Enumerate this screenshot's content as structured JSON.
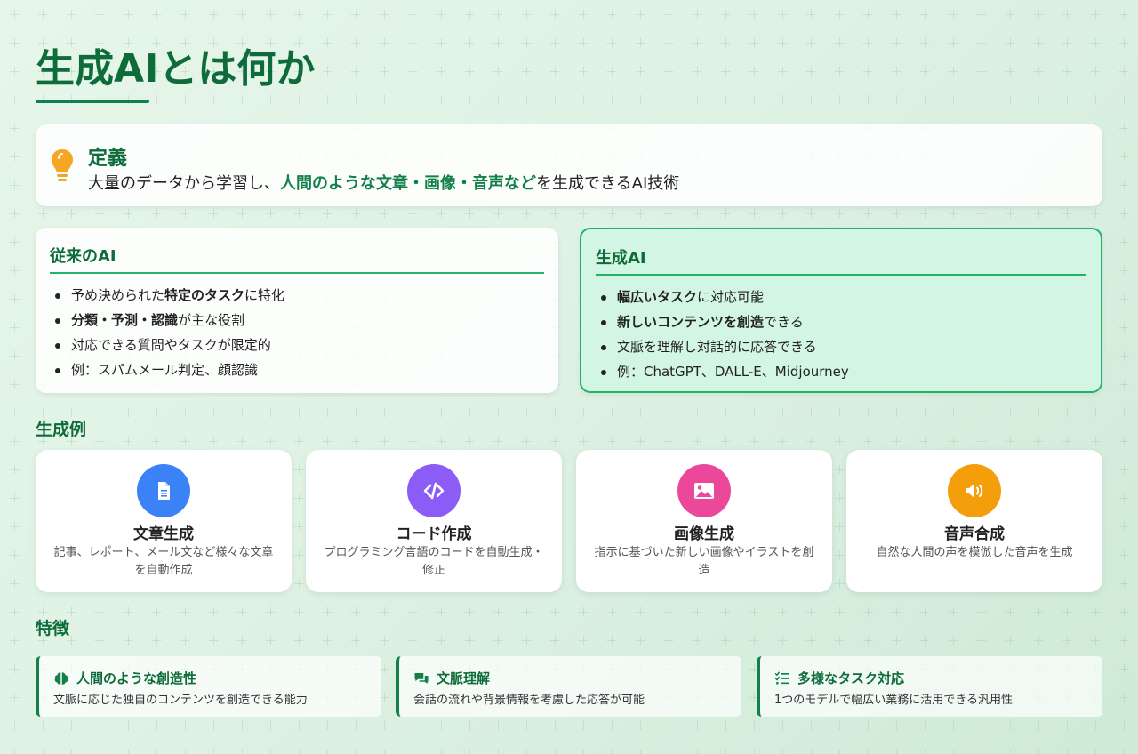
{
  "title": "生成AIとは何か",
  "definition": {
    "heading": "定義",
    "text_before": "大量のデータから学習し、",
    "highlight": "人間のような文章・画像・音声など",
    "text_after": "を生成できるAI技術",
    "icon": "lightbulb-icon"
  },
  "traditional": {
    "heading": "従来のAI",
    "items": [
      {
        "pre": "予め決められた",
        "bold": "特定のタスク",
        "post": "に特化"
      },
      {
        "pre": "",
        "bold": "分類・予測・認識",
        "post": "が主な役割"
      },
      {
        "pre": "対応できる質問やタスクが限定的",
        "bold": "",
        "post": ""
      },
      {
        "pre": "例：スパムメール判定、顔認識",
        "bold": "",
        "post": ""
      }
    ]
  },
  "generative": {
    "heading": "生成AI",
    "items": [
      {
        "pre": "",
        "bold": "幅広いタスク",
        "post": "に対応可能"
      },
      {
        "pre": "",
        "bold": "新しいコンテンツを創造",
        "post": "できる"
      },
      {
        "pre": "文脈を理解し対話的に応答できる",
        "bold": "",
        "post": ""
      },
      {
        "pre": "例：ChatGPT、DALL-E、Midjourney",
        "bold": "",
        "post": ""
      }
    ]
  },
  "examples_heading": "生成例",
  "examples": [
    {
      "title": "文章生成",
      "desc": "記事、レポート、メール文など様々な文章を自動作成",
      "icon": "document-icon",
      "color": "#3b82f6"
    },
    {
      "title": "コード作成",
      "desc": "プログラミング言語のコードを自動生成・修正",
      "icon": "code-icon",
      "color": "#8b5cf6"
    },
    {
      "title": "画像生成",
      "desc": "指示に基づいた新しい画像やイラストを創造",
      "icon": "image-icon",
      "color": "#ec4899"
    },
    {
      "title": "音声合成",
      "desc": "自然な人間の声を模倣した音声を生成",
      "icon": "speaker-icon",
      "color": "#f59e0b"
    }
  ],
  "features_heading": "特徴",
  "features": [
    {
      "title": "人間のような創造性",
      "desc": "文脈に応じた独自のコンテンツを創造できる能力",
      "icon": "brain-icon"
    },
    {
      "title": "文脈理解",
      "desc": "会話の流れや背景情報を考慮した応答が可能",
      "icon": "comments-icon"
    },
    {
      "title": "多様なタスク対応",
      "desc": "1つのモデルで幅広い業務に活用できる汎用性",
      "icon": "tasks-icon"
    }
  ],
  "colors": {
    "accent": "#13804a",
    "accent_light": "#22b26c",
    "bulb": "#f5a623"
  }
}
